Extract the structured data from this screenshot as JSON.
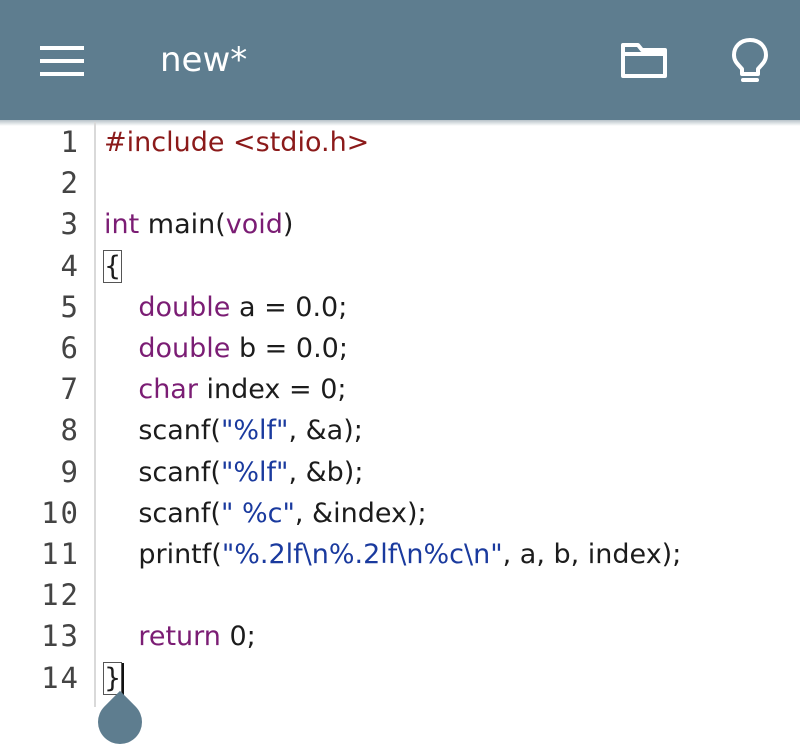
{
  "toolbar": {
    "title": "new*"
  },
  "icons": {
    "menu": "hamburger-menu-icon",
    "folder": "folder-icon",
    "hint": "lightbulb-icon"
  },
  "colors": {
    "toolbar": "#5e7d8f",
    "preprocessor": "#8b1a1a",
    "keyword": "#7b1d74",
    "string": "#1a3a9e"
  },
  "lines": [
    {
      "num": "1",
      "segs": [
        {
          "t": "#include <stdio.h>",
          "c": "pp"
        }
      ]
    },
    {
      "num": "2",
      "segs": []
    },
    {
      "num": "3",
      "segs": [
        {
          "t": "int",
          "c": "kw"
        },
        {
          "t": " main(",
          "c": ""
        },
        {
          "t": "void",
          "c": "kw"
        },
        {
          "t": ")",
          "c": ""
        }
      ]
    },
    {
      "num": "4",
      "segs": [
        {
          "t": "{",
          "c": "br-box"
        }
      ]
    },
    {
      "num": "5",
      "segs": [
        {
          "t": "    ",
          "c": ""
        },
        {
          "t": "double",
          "c": "kw"
        },
        {
          "t": " a = 0.0;",
          "c": ""
        }
      ]
    },
    {
      "num": "6",
      "segs": [
        {
          "t": "    ",
          "c": ""
        },
        {
          "t": "double",
          "c": "kw"
        },
        {
          "t": " b = 0.0;",
          "c": ""
        }
      ]
    },
    {
      "num": "7",
      "segs": [
        {
          "t": "    ",
          "c": ""
        },
        {
          "t": "char",
          "c": "kw"
        },
        {
          "t": " index = 0;",
          "c": ""
        }
      ]
    },
    {
      "num": "8",
      "segs": [
        {
          "t": "    scanf(",
          "c": ""
        },
        {
          "t": "\"%lf\"",
          "c": "str"
        },
        {
          "t": ", &a);",
          "c": ""
        }
      ]
    },
    {
      "num": "9",
      "segs": [
        {
          "t": "    scanf(",
          "c": ""
        },
        {
          "t": "\"%lf\"",
          "c": "str"
        },
        {
          "t": ", &b);",
          "c": ""
        }
      ]
    },
    {
      "num": "10",
      "segs": [
        {
          "t": "    scanf(",
          "c": ""
        },
        {
          "t": "\" %c\"",
          "c": "str"
        },
        {
          "t": ", &index);",
          "c": ""
        }
      ]
    },
    {
      "num": "11",
      "segs": [
        {
          "t": "    printf(",
          "c": ""
        },
        {
          "t": "\"%.2lf\\n%.2lf\\n%c\\n\"",
          "c": "str"
        },
        {
          "t": ", a, b, index);",
          "c": ""
        }
      ]
    },
    {
      "num": "12",
      "segs": []
    },
    {
      "num": "13",
      "segs": [
        {
          "t": "    ",
          "c": ""
        },
        {
          "t": "return",
          "c": "kw"
        },
        {
          "t": " 0;",
          "c": ""
        }
      ]
    },
    {
      "num": "14",
      "segs": [
        {
          "t": "}",
          "c": "br-box"
        }
      ]
    }
  ],
  "cursor_line": "14"
}
